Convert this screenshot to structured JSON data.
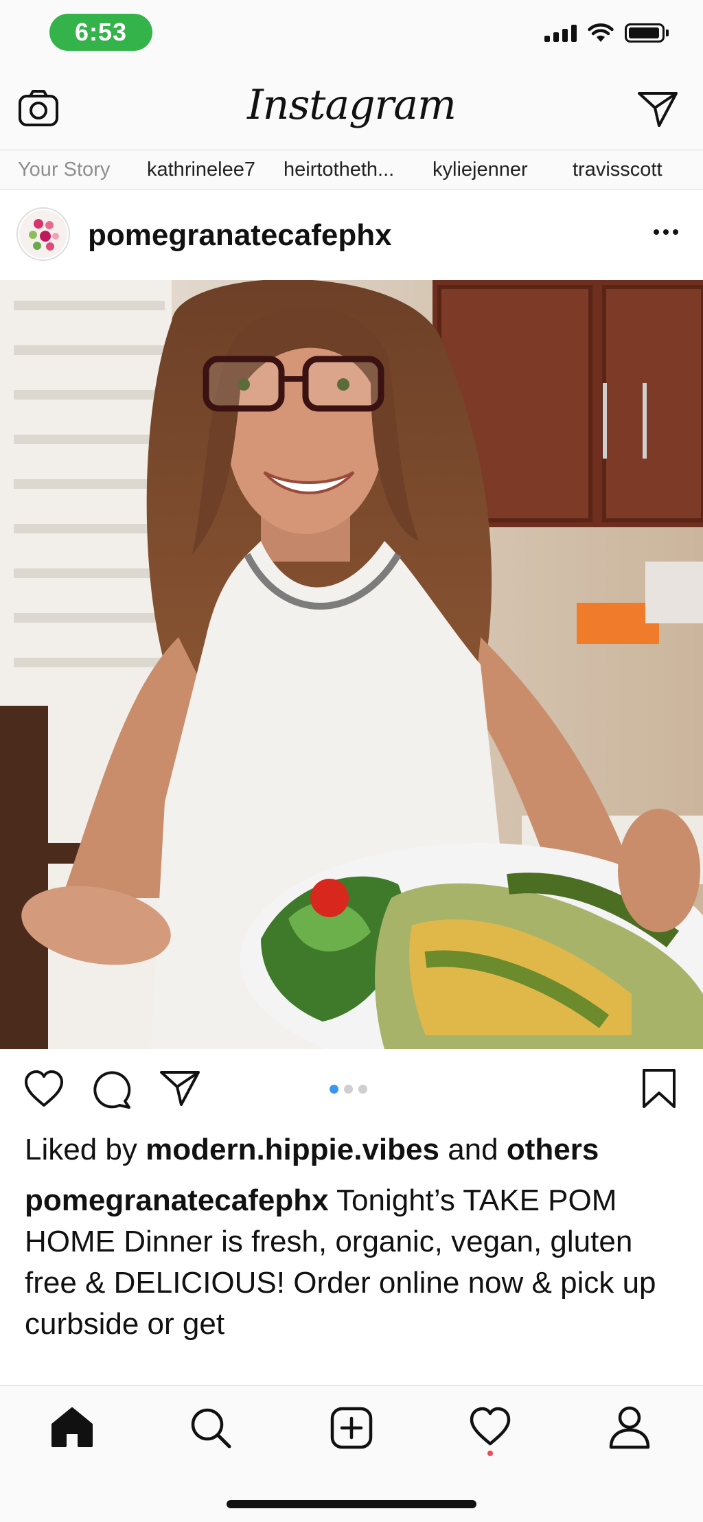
{
  "status": {
    "time": "6:53"
  },
  "header": {
    "app_title": "Instagram"
  },
  "stories": [
    {
      "label": "Your Story"
    },
    {
      "label": "kathrinelee7"
    },
    {
      "label": "heirtotheth..."
    },
    {
      "label": "kyliejenner"
    },
    {
      "label": "travisscott"
    }
  ],
  "post": {
    "username": "pomegranatecafephx",
    "carousel": {
      "current": 1,
      "total": 3
    },
    "likes": {
      "prefix": "Liked by ",
      "user": "modern.hippie.vibes",
      "middle": " and ",
      "rest": "others"
    },
    "caption": {
      "user": "pomegranatecafephx",
      "text": " Tonight’s TAKE POM HOME Dinner is fresh, organic, vegan, gluten free & DELICIOUS!  Order online now & pick up curbside or get"
    }
  },
  "icons": {
    "camera": "camera-icon",
    "send": "paper-plane-icon",
    "more": "more-horizontal-icon",
    "like": "heart-icon",
    "comment": "comment-icon",
    "share": "paper-plane-icon",
    "save": "bookmark-icon",
    "home": "home-icon",
    "search": "search-icon",
    "new_post": "plus-square-icon",
    "activity": "heart-icon",
    "profile": "profile-icon"
  },
  "colors": {
    "time_pill": "#34b34a",
    "active_dot": "#3897f0",
    "notification_dot": "#ed4956"
  }
}
